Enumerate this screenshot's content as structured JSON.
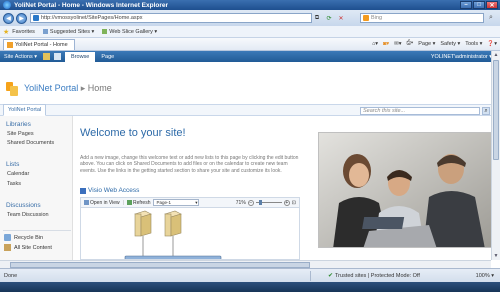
{
  "window": {
    "title": "YoliNet Portal - Home - Windows Internet Explorer"
  },
  "addressbar": {
    "url": "http://vmossyolinet/SitePages/Home.aspx",
    "search_placeholder": "Bing"
  },
  "favorites": {
    "label": "Favorites",
    "items": [
      "Suggested Sites ▾",
      "Web Slice Gallery ▾"
    ]
  },
  "tab": {
    "label": "YoliNet Portal - Home"
  },
  "commandbar": {
    "page": "Page ▾",
    "safety": "Safety ▾",
    "tools": "Tools ▾",
    "help": "❓▾"
  },
  "sp_top": {
    "site_actions": "Site Actions ▾",
    "tabs": [
      "Browse",
      "Page"
    ],
    "user": "YOLINET\\administrator ▾"
  },
  "portal": {
    "title": "YoliNet Portal",
    "separator": "▸",
    "crumb": "Home"
  },
  "quicklaunch": {
    "tab_label": "YoliNet Portal",
    "search_placeholder": "Search this site..."
  },
  "leftnav": {
    "libraries": {
      "title": "Libraries",
      "items": [
        "Site Pages",
        "Shared Documents"
      ]
    },
    "lists": {
      "title": "Lists",
      "items": [
        "Calendar",
        "Tasks"
      ]
    },
    "discussions": {
      "title": "Discussions",
      "items": [
        "Team Discussion"
      ]
    },
    "recycle_bin": "Recycle Bin",
    "all_site_content": "All Site Content"
  },
  "main": {
    "title": "Welcome to your site!",
    "text": "Add a new image, change this welcome text or add new lists to this page by clicking the edit button above. You can click on Shared Documents to add files or on the calendar to create new team events. Use the links in the getting started section to share your site and customize its look."
  },
  "visio": {
    "title": "Visio Web Access",
    "open_in_view": "Open in View",
    "refresh": "Refresh",
    "page_select": "Page-1",
    "zoom": "71%"
  },
  "status": {
    "left": "Done",
    "zone": "Trusted sites | Protected Mode: Off",
    "zoom": "100% ▾"
  },
  "colors": {
    "sp_blue": "#2e6aa6",
    "link_blue": "#3a6fa8",
    "title_blue": "#2d6aa8"
  }
}
